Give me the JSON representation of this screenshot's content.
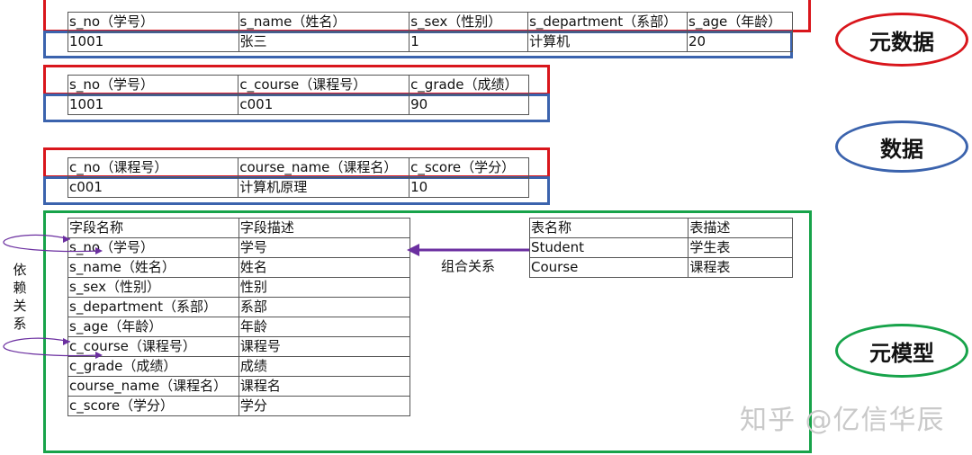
{
  "t1": {
    "header": [
      "s_no（学号）",
      "s_name（姓名）",
      "s_sex（性别）",
      "s_department（系部）",
      "s_age（年龄）"
    ],
    "row": [
      "1001",
      "张三",
      "1",
      "计算机",
      "20"
    ]
  },
  "t2": {
    "header": [
      "s_no（学号）",
      "c_course（课程号）",
      "c_grade（成绩）"
    ],
    "row": [
      "1001",
      "c001",
      "90"
    ]
  },
  "t3": {
    "header": [
      "c_no（课程号）",
      "course_name（课程名）",
      "c_score（学分）"
    ],
    "row": [
      "c001",
      "计算机原理",
      "10"
    ]
  },
  "fields": {
    "header": [
      "字段名称",
      "字段描述"
    ],
    "rows": [
      [
        "s_no（学号）",
        "学号"
      ],
      [
        "s_name（姓名）",
        "姓名"
      ],
      [
        "s_sex（性别）",
        "性别"
      ],
      [
        "s_department（系部）",
        "系部"
      ],
      [
        "s_age（年龄）",
        "年龄"
      ],
      [
        "c_course（课程号）",
        "课程号"
      ],
      [
        "c_grade（成绩）",
        "成绩"
      ],
      [
        "course_name（课程名）",
        "课程名"
      ],
      [
        "c_score（学分）",
        "学分"
      ]
    ]
  },
  "tables": {
    "header": [
      "表名称",
      "表描述"
    ],
    "rows": [
      [
        "Student",
        "学生表"
      ],
      [
        "Course",
        "课程表"
      ]
    ]
  },
  "labels": {
    "metadata": "元数据",
    "data": "数据",
    "metamodel": "元模型",
    "composition": "组合关系",
    "dependency": "依赖关系",
    "watermark": "知乎 @亿信华辰"
  },
  "colors": {
    "metadata": "#d9161c",
    "data": "#3b63ad",
    "metamodel": "#17a34a",
    "arrow": "#6b2fa0"
  }
}
